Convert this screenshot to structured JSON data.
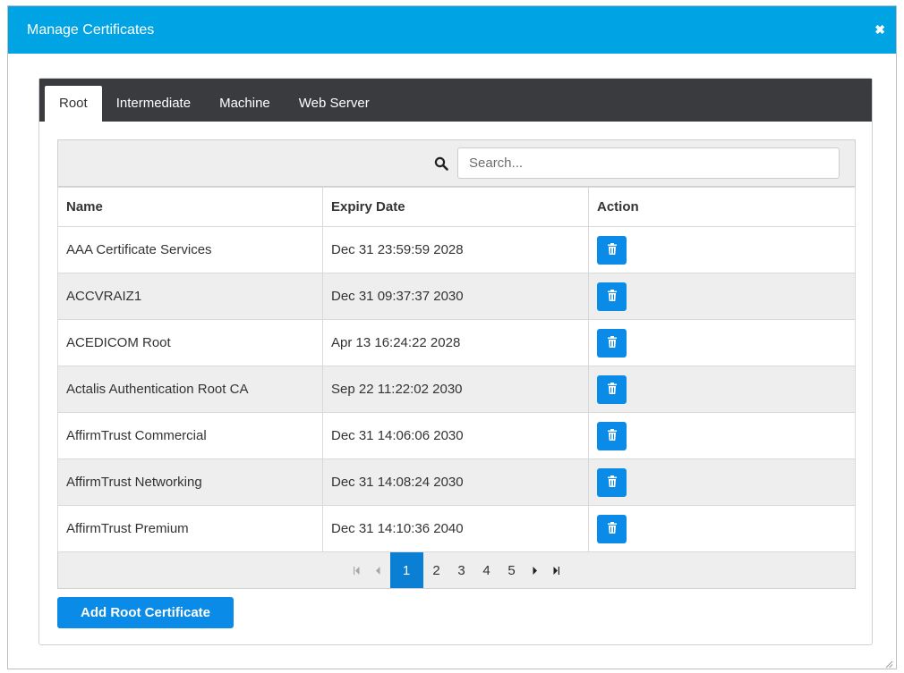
{
  "dialog": {
    "title": "Manage Certificates",
    "close_icon": "close-icon"
  },
  "tabs": [
    {
      "label": "Root",
      "active": true
    },
    {
      "label": "Intermediate",
      "active": false
    },
    {
      "label": "Machine",
      "active": false
    },
    {
      "label": "Web Server",
      "active": false
    }
  ],
  "search": {
    "placeholder": "Search...",
    "value": "",
    "icon": "search-icon"
  },
  "table": {
    "columns": [
      "Name",
      "Expiry Date",
      "Action"
    ],
    "rows": [
      {
        "name": "AAA Certificate Services",
        "expiry": "Dec 31 23:59:59 2028",
        "action_icon": "trash-icon"
      },
      {
        "name": "ACCVRAIZ1",
        "expiry": "Dec 31 09:37:37 2030",
        "action_icon": "trash-icon"
      },
      {
        "name": "ACEDICOM Root",
        "expiry": "Apr 13 16:24:22 2028",
        "action_icon": "trash-icon"
      },
      {
        "name": "Actalis Authentication Root CA",
        "expiry": "Sep 22 11:22:02 2030",
        "action_icon": "trash-icon"
      },
      {
        "name": "AffirmTrust Commercial",
        "expiry": "Dec 31 14:06:06 2030",
        "action_icon": "trash-icon"
      },
      {
        "name": "AffirmTrust Networking",
        "expiry": "Dec 31 14:08:24 2030",
        "action_icon": "trash-icon"
      },
      {
        "name": "AffirmTrust Premium",
        "expiry": "Dec 31 14:10:36 2040",
        "action_icon": "trash-icon"
      }
    ]
  },
  "pagination": {
    "pages": [
      "1",
      "2",
      "3",
      "4",
      "5"
    ],
    "current": "1",
    "first_icon": "first-page-icon",
    "prev_icon": "prev-page-icon",
    "next_icon": "next-page-icon",
    "last_icon": "last-page-icon"
  },
  "add_button": {
    "label": "Add Root Certificate"
  },
  "colors": {
    "title_bar": "#00a4e4",
    "tab_strip": "#3a3b3e",
    "button": "#0b8be8",
    "active_page": "#0b7fd4"
  }
}
